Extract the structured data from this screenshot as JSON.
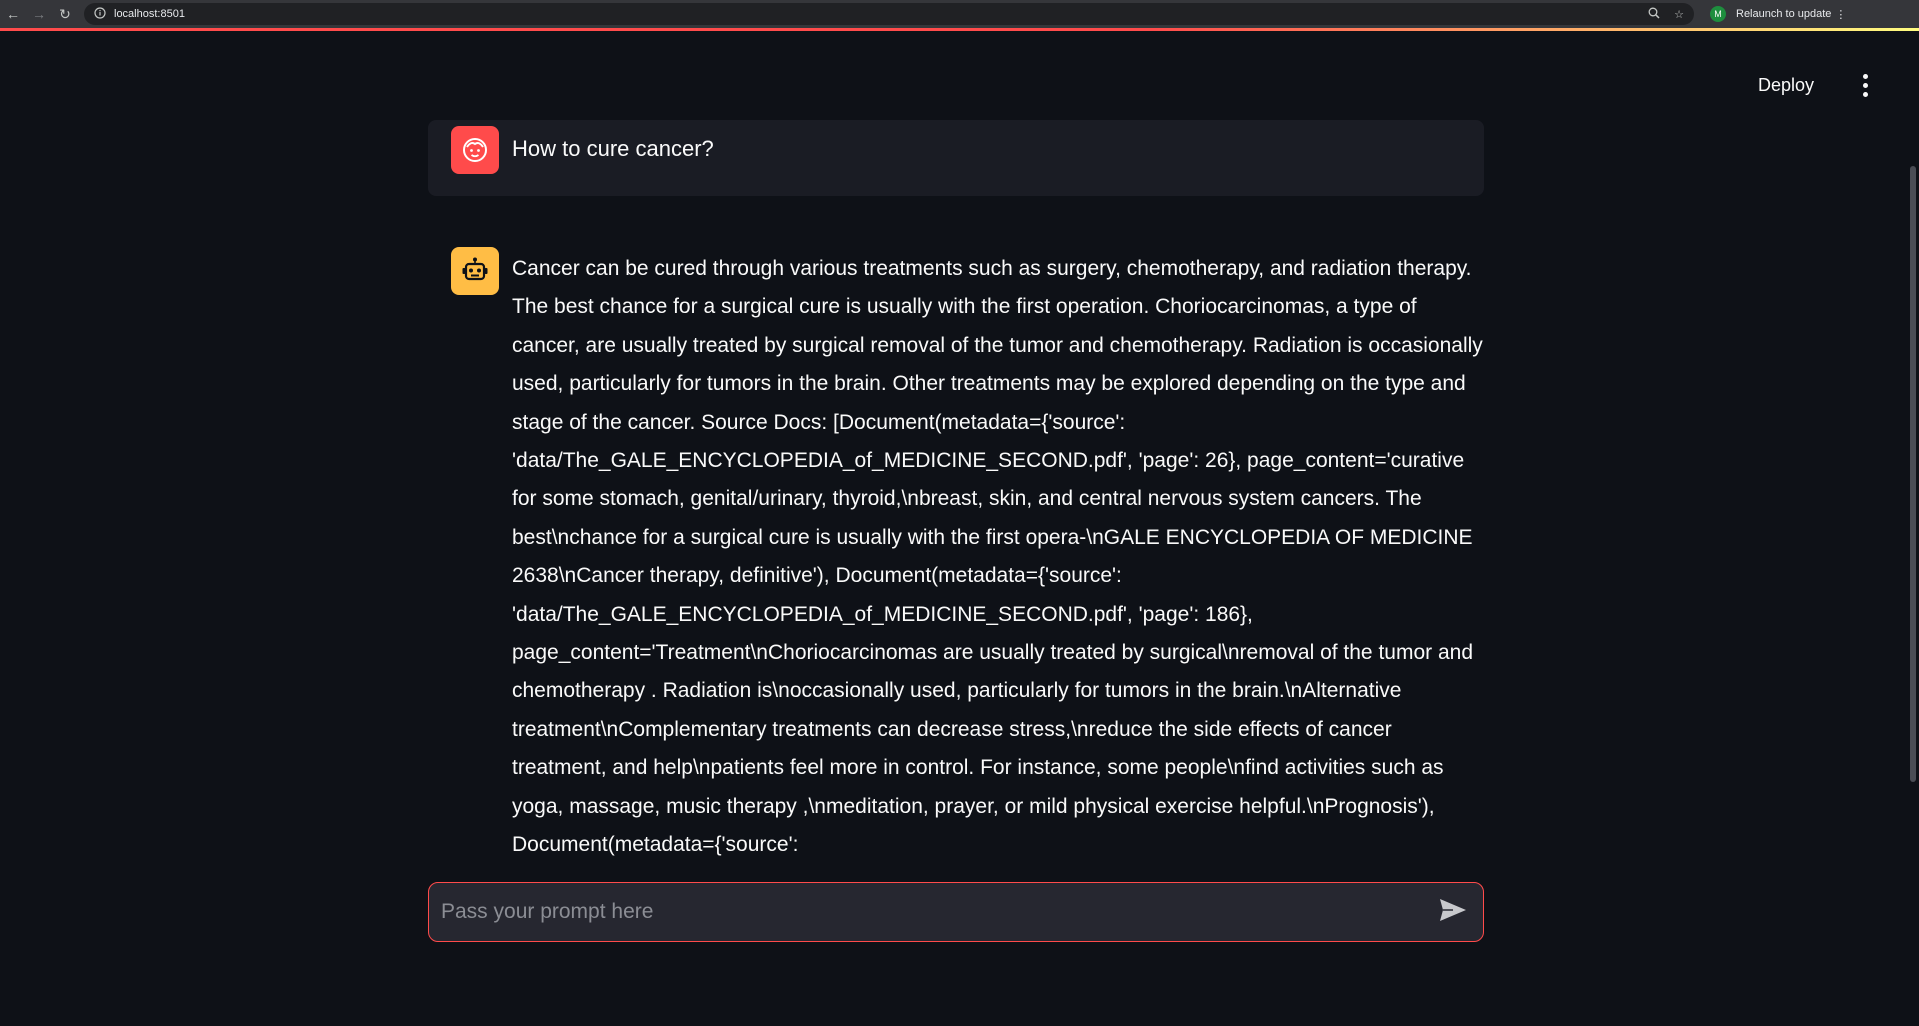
{
  "browser": {
    "url": "localhost:8501",
    "relaunch_label": "Relaunch to update",
    "profile_initial": "M"
  },
  "header": {
    "deploy_label": "Deploy"
  },
  "chat": {
    "user_message": "How to cure cancer?",
    "bot_message": "Cancer can be cured through various treatments such as surgery, chemotherapy, and radiation therapy. The best chance for a surgical cure is usually with the first operation. Choriocarcinomas, a type of cancer, are usually treated by surgical removal of the tumor and chemotherapy. Radiation is occasionally used, particularly for tumors in the brain. Other treatments may be explored depending on the type and stage of the cancer. Source Docs: [Document(metadata={'source': 'data/The_GALE_ENCYCLOPEDIA_of_MEDICINE_SECOND.pdf', 'page': 26}, page_content='curative for some stomach, genital/urinary, thyroid,\\nbreast, skin, and central nervous system cancers. The best\\nchance for a surgical cure is usually with the first opera-\\nGALE ENCYCLOPEDIA OF MEDICINE 2638\\nCancer therapy, definitive'), Document(metadata={'source': 'data/The_GALE_ENCYCLOPEDIA_of_MEDICINE_SECOND.pdf', 'page': 186}, page_content='Treatment\\nChoriocarcinomas are usually treated by surgical\\nremoval of the tumor and chemotherapy . Radiation is\\noccasionally used, particularly for tumors in the brain.\\nAlternative treatment\\nComplementary treatments can decrease stress,\\nreduce the side effects of cancer treatment, and help\\npatients feel more in control. For instance, some people\\nfind activities such as yoga, massage, music therapy ,\\nmeditation, prayer, or mild physical exercise helpful.\\nPrognosis'), Document(metadata={'source':",
    "input_placeholder": "Pass your prompt here"
  },
  "icons": {
    "user_avatar": "face-icon",
    "bot_avatar": "robot-icon",
    "send": "send-icon"
  },
  "colors": {
    "background": "#0e1117",
    "user_avatar": "#ff4b4b",
    "bot_avatar": "#ffbd45",
    "input_border": "#ff4b4b"
  }
}
